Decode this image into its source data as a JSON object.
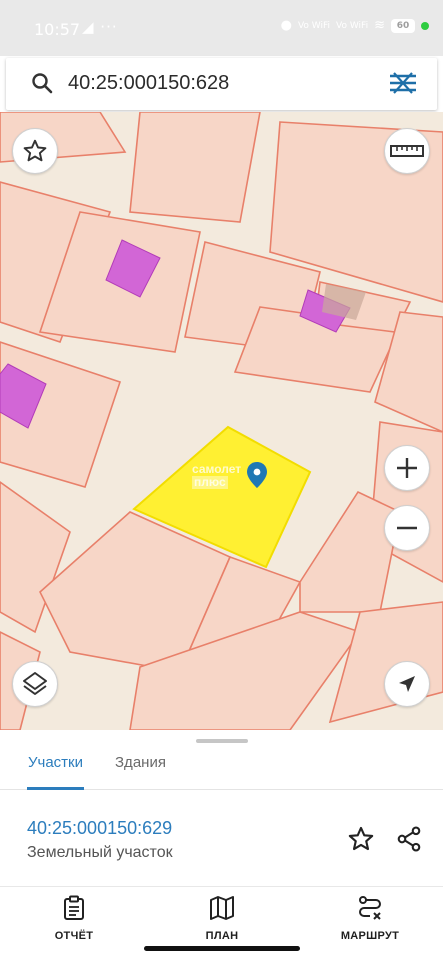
{
  "status_bar": {
    "time": "10:57",
    "extra_indicators": "◢ ···",
    "signal1": "Vo WiFi",
    "signal2": "Vo WiFi",
    "battery": "60"
  },
  "search": {
    "query": "40:25:000150:628",
    "icon": "search-icon",
    "filter_icon": "filter-icon"
  },
  "map": {
    "watermark_line1": "самолет",
    "watermark_line2": "плюс",
    "colors": {
      "background": "#f3eadd",
      "parcel_fill": "#f7d6c7",
      "parcel_stroke": "#e8806a",
      "building": "#d266d6",
      "selected": "#fff032"
    },
    "buttons": [
      "star-icon",
      "ruler-icon",
      "zoom-in-icon",
      "zoom-out-icon",
      "layers-icon",
      "location-arrow-icon"
    ]
  },
  "sheet": {
    "tabs": [
      {
        "label": "Участки",
        "active": true
      },
      {
        "label": "Здания",
        "active": false
      }
    ],
    "parcel_number": "40:25:000150:629",
    "parcel_type": "Земельный участок"
  },
  "bottom_nav": {
    "items": [
      {
        "label": "ОТЧЁТ",
        "icon": "clipboard-icon"
      },
      {
        "label": "ПЛАН",
        "icon": "map-icon"
      },
      {
        "label": "МАРШРУТ",
        "icon": "route-icon"
      }
    ]
  }
}
